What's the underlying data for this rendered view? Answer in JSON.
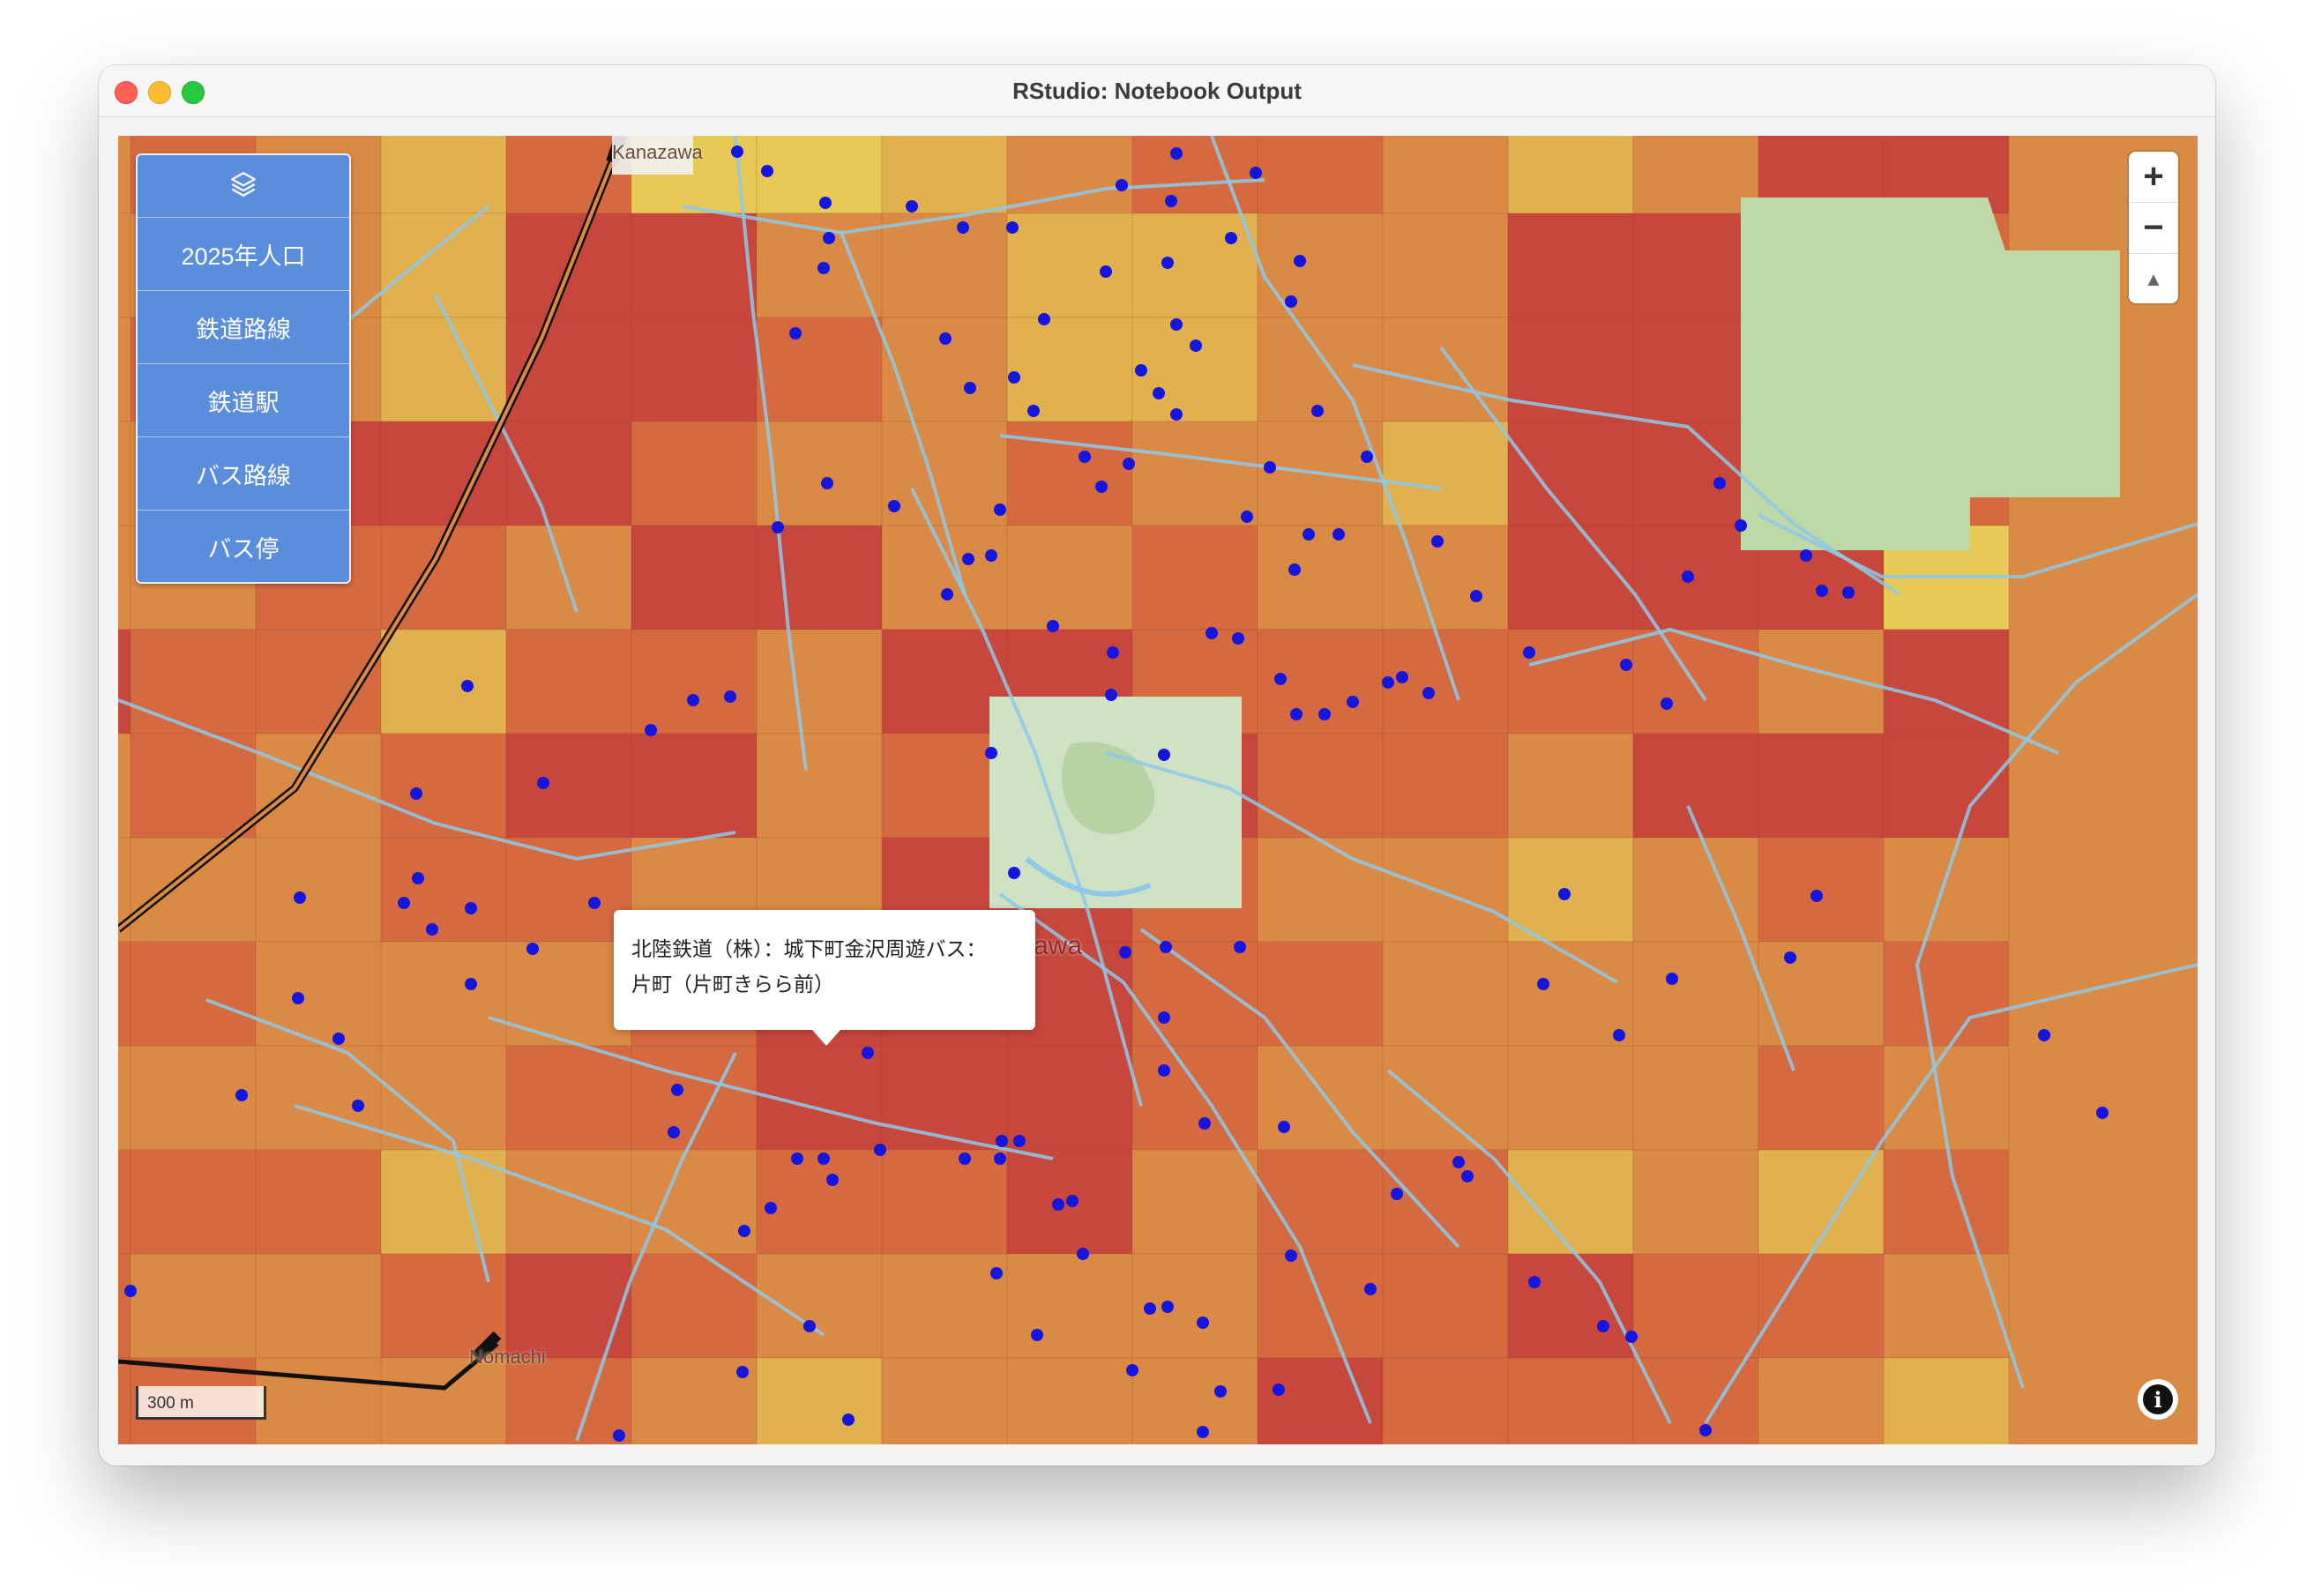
{
  "window": {
    "title": "RStudio: Notebook Output"
  },
  "layer_control": {
    "icon": "layers-icon",
    "items": [
      "2025年人口",
      "鉄道路線",
      "鉄道駅",
      "バス路線",
      "バス停"
    ]
  },
  "zoom_control": {
    "zoom_in": "+",
    "zoom_out": "−",
    "compass": "▲"
  },
  "popup": {
    "line1": "北陸鉄道（株）：城下町金沢周遊バス：",
    "line2": "片町（片町きらら前）"
  },
  "scale_bar": {
    "label": "300 m"
  },
  "place_labels": {
    "north_station": "Kanazawa",
    "south_station": "Nomachi",
    "city": "awa"
  },
  "info_button": {
    "icon": "info-icon",
    "glyph": "i"
  },
  "colors": {
    "population_high": "#c8473d",
    "population_mid_high": "#d56a40",
    "population_mid": "#db8a45",
    "population_low": "#e2b14f",
    "population_lowest": "#e7c955",
    "park": "#cde0c0",
    "bus_route": "#8ec9e8",
    "bus_stop": "#1515e0",
    "rail": "#111111",
    "layer_panel": "#5a8ddc"
  }
}
